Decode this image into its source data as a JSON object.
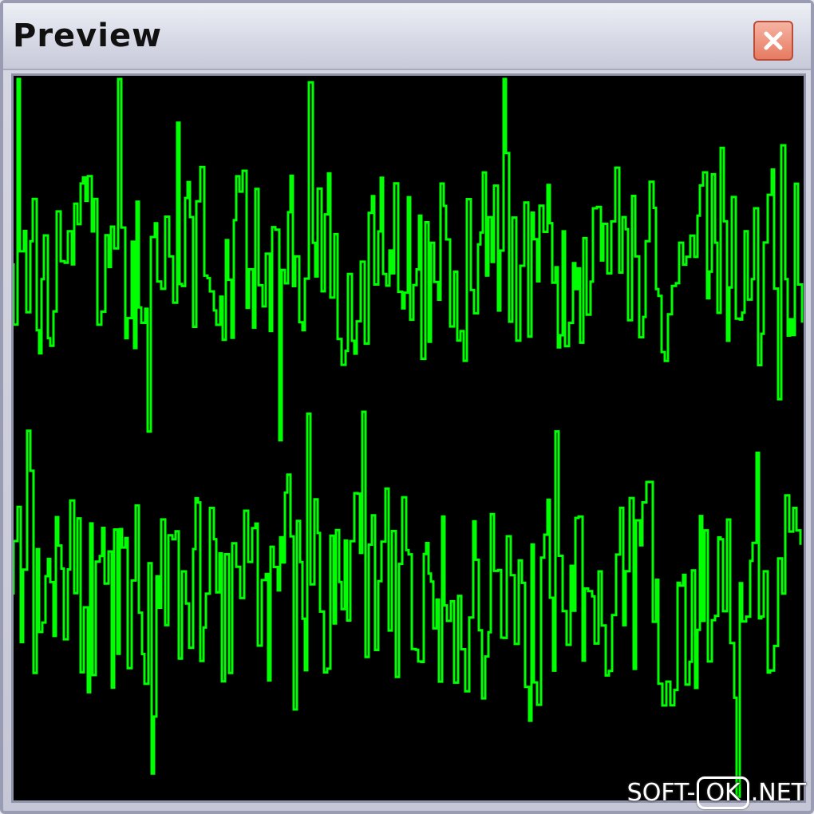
{
  "window": {
    "title": "Preview",
    "close_icon": "close-icon"
  },
  "plot": {
    "background_color": "#000000",
    "trace_color": "#00ff00",
    "channels": [
      {
        "name": "channel-top"
      },
      {
        "name": "channel-bottom"
      }
    ]
  },
  "watermark": {
    "prefix": "SOFT-",
    "boxed": "OK",
    "suffix": ".NET"
  }
}
